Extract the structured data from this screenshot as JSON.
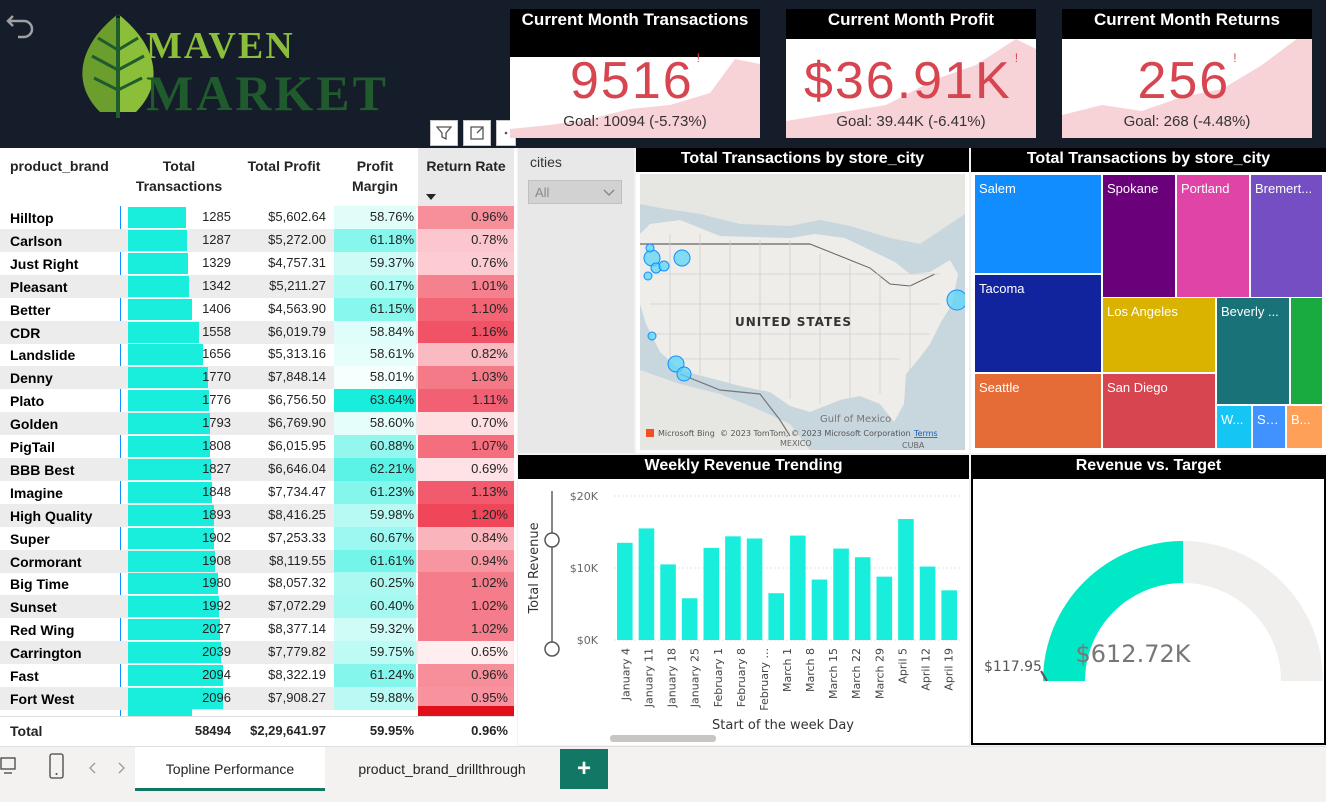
{
  "brand": {
    "line1": "MAVEN",
    "line2": "MARKET"
  },
  "kpis": [
    {
      "title": "Current Month Transactions",
      "value": "9516",
      "indicator": "!",
      "goal": "Goal: 10094 (-5.73%)"
    },
    {
      "title": "Current Month Profit",
      "value": "$36.91K",
      "indicator": "!",
      "goal": "Goal: 39.44K (-6.41%)"
    },
    {
      "title": "Current Month Returns",
      "value": "256",
      "indicator": "!",
      "goal": "Goal: 268 (-4.48%)"
    }
  ],
  "matrix": {
    "headers": {
      "brand": "product_brand",
      "transactions": "Total Transactions",
      "profit": "Total Profit",
      "margin": "Profit Margin",
      "return": "Return Rate"
    },
    "rows": [
      {
        "brand": "Hilltop",
        "transactions": "1285",
        "profit": "$5,602.64",
        "margin": "58.76%",
        "return": "0.96%"
      },
      {
        "brand": "Carlson",
        "transactions": "1287",
        "profit": "$5,272.00",
        "margin": "61.18%",
        "return": "0.78%"
      },
      {
        "brand": "Just Right",
        "transactions": "1329",
        "profit": "$4,757.31",
        "margin": "59.37%",
        "return": "0.76%"
      },
      {
        "brand": "Pleasant",
        "transactions": "1342",
        "profit": "$5,211.27",
        "margin": "60.17%",
        "return": "1.01%"
      },
      {
        "brand": "Better",
        "transactions": "1406",
        "profit": "$4,563.90",
        "margin": "61.15%",
        "return": "1.10%"
      },
      {
        "brand": "CDR",
        "transactions": "1558",
        "profit": "$6,019.79",
        "margin": "58.84%",
        "return": "1.16%"
      },
      {
        "brand": "Landslide",
        "transactions": "1656",
        "profit": "$5,313.16",
        "margin": "58.61%",
        "return": "0.82%"
      },
      {
        "brand": "Denny",
        "transactions": "1770",
        "profit": "$7,848.14",
        "margin": "58.01%",
        "return": "1.03%"
      },
      {
        "brand": "Plato",
        "transactions": "1776",
        "profit": "$6,756.50",
        "margin": "63.64%",
        "return": "1.11%"
      },
      {
        "brand": "Golden",
        "transactions": "1793",
        "profit": "$6,769.90",
        "margin": "58.60%",
        "return": "0.70%"
      },
      {
        "brand": "PigTail",
        "transactions": "1808",
        "profit": "$6,015.95",
        "margin": "60.88%",
        "return": "1.07%"
      },
      {
        "brand": "BBB Best",
        "transactions": "1827",
        "profit": "$6,646.04",
        "margin": "62.21%",
        "return": "0.69%"
      },
      {
        "brand": "Imagine",
        "transactions": "1848",
        "profit": "$7,734.47",
        "margin": "61.23%",
        "return": "1.13%"
      },
      {
        "brand": "High Quality",
        "transactions": "1893",
        "profit": "$8,416.25",
        "margin": "59.98%",
        "return": "1.20%"
      },
      {
        "brand": "Super",
        "transactions": "1902",
        "profit": "$7,253.33",
        "margin": "60.67%",
        "return": "0.84%"
      },
      {
        "brand": "Cormorant",
        "transactions": "1908",
        "profit": "$8,119.55",
        "margin": "61.61%",
        "return": "0.94%"
      },
      {
        "brand": "Big Time",
        "transactions": "1980",
        "profit": "$8,057.32",
        "margin": "60.25%",
        "return": "1.02%"
      },
      {
        "brand": "Sunset",
        "transactions": "1992",
        "profit": "$7,072.29",
        "margin": "60.40%",
        "return": "1.02%"
      },
      {
        "brand": "Red Wing",
        "transactions": "2027",
        "profit": "$8,377.14",
        "margin": "59.32%",
        "return": "1.02%"
      },
      {
        "brand": "Carrington",
        "transactions": "2039",
        "profit": "$7,779.82",
        "margin": "59.75%",
        "return": "0.65%"
      },
      {
        "brand": "Fast",
        "transactions": "2094",
        "profit": "$8,322.19",
        "margin": "61.24%",
        "return": "0.96%"
      },
      {
        "brand": "Fort West",
        "transactions": "2096",
        "profit": "$7,908.27",
        "margin": "59.88%",
        "return": "0.95%"
      }
    ],
    "total": {
      "label": "Total",
      "transactions": "58494",
      "profit": "$2,29,641.97",
      "margin": "59.95%",
      "return": "0.96%"
    }
  },
  "slicer": {
    "title": "cities",
    "value": "All"
  },
  "map": {
    "title": "Total Transactions by store_city",
    "country_label": "UNITED STATES",
    "gulf_label": "Gulf of Mexico",
    "mexico_label": "MEXICO",
    "cuba_label": "CUBA",
    "attribution": "© 2023 TomTom, © 2023 Microsoft Corporation",
    "bing": "Microsoft Bing",
    "terms": "Terms"
  },
  "treemap": {
    "title": "Total Transactions by store_city",
    "tiles": [
      {
        "label": "Salem",
        "color": "#118dff"
      },
      {
        "label": "Spokane",
        "color": "#6b007b"
      },
      {
        "label": "Portland",
        "color": "#e044a7"
      },
      {
        "label": "Bremert...",
        "color": "#744ec2"
      },
      {
        "label": "Tacoma",
        "color": "#12239e"
      },
      {
        "label": "Los Angeles",
        "color": "#d9b300"
      },
      {
        "label": "Beverly ...",
        "color": "#197278"
      },
      {
        "label": "",
        "color": "#1aab40"
      },
      {
        "label": "Seattle",
        "color": "#e66c37"
      },
      {
        "label": "San Diego",
        "color": "#d64550"
      },
      {
        "label": "W...",
        "color": "#15c6f4"
      },
      {
        "label": "Sa...",
        "color": "#4092ff"
      },
      {
        "label": "B...",
        "color": "#ffa058"
      }
    ]
  },
  "weekly": {
    "title": "Weekly Revenue Trending",
    "chart_data": {
      "type": "bar",
      "title": "Weekly Revenue Trending",
      "xlabel": "Start of the week Day",
      "ylabel": "Total Revenue",
      "yticks": [
        "$0K",
        "$10K",
        "$20K"
      ],
      "ylim": [
        0,
        20000
      ],
      "categories": [
        "January 4",
        "January 11",
        "January 18",
        "January 25",
        "February 1",
        "February 8",
        "February ...",
        "March 1",
        "March 8",
        "March 15",
        "March 22",
        "March 29",
        "April 5",
        "April 12",
        "April 19"
      ],
      "values": [
        13500,
        15500,
        10500,
        5800,
        12800,
        14400,
        14100,
        6500,
        14500,
        8400,
        12700,
        11500,
        8800,
        16800,
        10200,
        6900
      ]
    }
  },
  "gauge": {
    "title": "Revenue vs. Target",
    "value": "$612.72K",
    "min_label": "$117.95",
    "fill_fraction": 0.5
  },
  "tabs": {
    "topline": "Topline Performance",
    "drill": "product_brand_drillthrough",
    "add": "+"
  }
}
